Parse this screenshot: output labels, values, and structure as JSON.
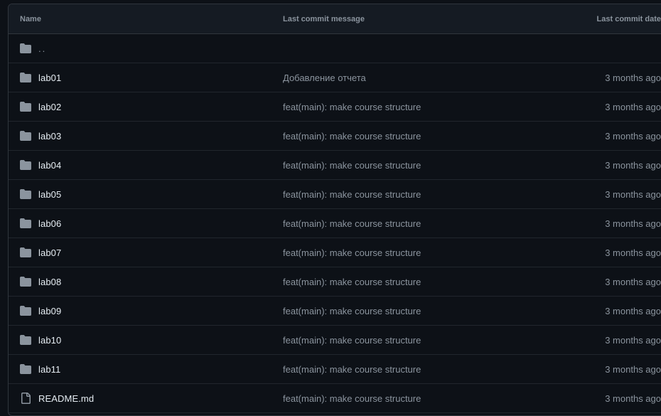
{
  "table": {
    "headers": {
      "name": "Name",
      "message": "Last commit message",
      "date": "Last commit date"
    },
    "parent": "..",
    "rows": [
      {
        "type": "folder",
        "name": "lab01",
        "message": "Добавление отчета",
        "date": "3 months ago"
      },
      {
        "type": "folder",
        "name": "lab02",
        "message": "feat(main): make course structure",
        "date": "3 months ago"
      },
      {
        "type": "folder",
        "name": "lab03",
        "message": "feat(main): make course structure",
        "date": "3 months ago"
      },
      {
        "type": "folder",
        "name": "lab04",
        "message": "feat(main): make course structure",
        "date": "3 months ago"
      },
      {
        "type": "folder",
        "name": "lab05",
        "message": "feat(main): make course structure",
        "date": "3 months ago"
      },
      {
        "type": "folder",
        "name": "lab06",
        "message": "feat(main): make course structure",
        "date": "3 months ago"
      },
      {
        "type": "folder",
        "name": "lab07",
        "message": "feat(main): make course structure",
        "date": "3 months ago"
      },
      {
        "type": "folder",
        "name": "lab08",
        "message": "feat(main): make course structure",
        "date": "3 months ago"
      },
      {
        "type": "folder",
        "name": "lab09",
        "message": "feat(main): make course structure",
        "date": "3 months ago"
      },
      {
        "type": "folder",
        "name": "lab10",
        "message": "feat(main): make course structure",
        "date": "3 months ago"
      },
      {
        "type": "folder",
        "name": "lab11",
        "message": "feat(main): make course structure",
        "date": "3 months ago"
      },
      {
        "type": "file",
        "name": "README.md",
        "message": "feat(main): make course structure",
        "date": "3 months ago"
      }
    ]
  },
  "icons": {
    "folder": "folder-icon",
    "file": "file-icon"
  },
  "colors": {
    "background": "#0d1117",
    "header_background": "#151b23",
    "border": "#30363d",
    "row_border": "#21262d",
    "text_primary": "#e6edf3",
    "text_muted": "#8b949e",
    "icon": "#8b949e"
  }
}
